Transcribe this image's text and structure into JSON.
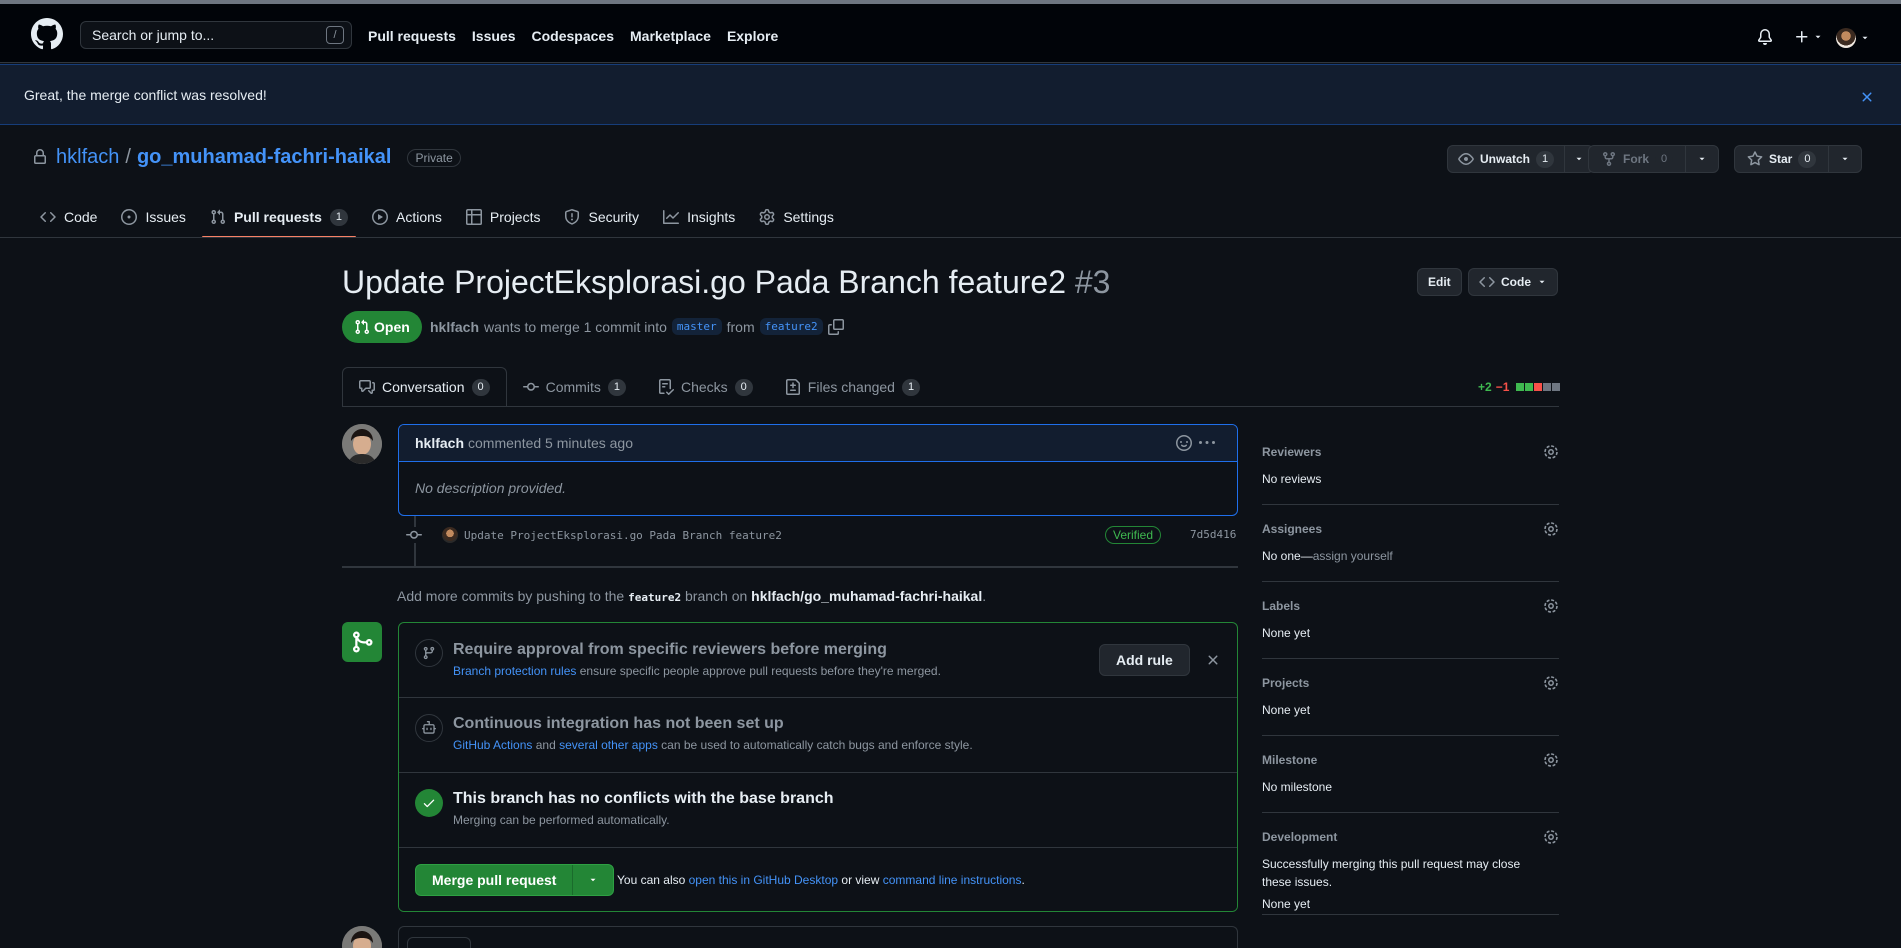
{
  "header": {
    "search_placeholder": "Search or jump to...",
    "search_key": "/",
    "nav": [
      "Pull requests",
      "Issues",
      "Codespaces",
      "Marketplace",
      "Explore"
    ]
  },
  "flash": {
    "message": "Great, the merge conflict was resolved!"
  },
  "repo": {
    "owner": "hklfach",
    "separator": "/",
    "name": "go_muhamad-fachri-haikal",
    "visibility": "Private",
    "unwatch_label": "Unwatch",
    "unwatch_count": "1",
    "fork_label": "Fork",
    "fork_count": "0",
    "star_label": "Star",
    "star_count": "0"
  },
  "repo_tabs": {
    "code": "Code",
    "issues": "Issues",
    "pull_requests": "Pull requests",
    "pull_requests_count": "1",
    "actions": "Actions",
    "projects": "Projects",
    "security": "Security",
    "insights": "Insights",
    "settings": "Settings"
  },
  "pr": {
    "title": "Update ProjectEksplorasi.go Pada Branch feature2",
    "number": "#3",
    "edit_label": "Edit",
    "code_label": "Code",
    "state": "Open",
    "author": "hklfach",
    "meta_text": "wants to merge 1 commit into",
    "base_branch": "master",
    "from_text": "from",
    "head_branch": "feature2"
  },
  "pr_tabs": {
    "conversation": "Conversation",
    "conversation_count": "0",
    "commits": "Commits",
    "commits_count": "1",
    "checks": "Checks",
    "checks_count": "0",
    "files": "Files changed",
    "files_count": "1",
    "additions": "+2",
    "deletions": "−1"
  },
  "comment": {
    "author": "hklfach",
    "action": "commented 5 minutes ago",
    "body": "No description provided."
  },
  "commit": {
    "message": "Update ProjectEksplorasi.go Pada Branch feature2",
    "verified": "Verified",
    "sha": "7d5d416"
  },
  "push_note": {
    "prefix": "Add more commits by pushing to the",
    "branch": "feature2",
    "middle": "branch on",
    "repo": "hklfach/go_muhamad-fachri-haikal",
    "suffix": "."
  },
  "mergebox": {
    "protection_title": "Require approval from specific reviewers before merging",
    "protection_link": "Branch protection rules",
    "protection_text": "ensure specific people approve pull requests before they're merged.",
    "add_rule": "Add rule",
    "ci_title": "Continuous integration has not been set up",
    "ci_link1": "GitHub Actions",
    "ci_and": "and",
    "ci_link2": "several other apps",
    "ci_text": "can be used to automatically catch bugs and enforce style.",
    "conflict_title": "This branch has no conflicts with the base branch",
    "conflict_sub": "Merging can be performed automatically.",
    "merge_button": "Merge pull request",
    "also_prefix": "You can also",
    "also_link1": "open this in GitHub Desktop",
    "also_mid": "or view",
    "also_link2": "command line instructions",
    "also_suffix": "."
  },
  "sidebar": {
    "reviewers_h": "Reviewers",
    "reviewers_v": "No reviews",
    "assignees_h": "Assignees",
    "assignees_v1": "No one—",
    "assignees_v2": "assign yourself",
    "labels_h": "Labels",
    "labels_v": "None yet",
    "projects_h": "Projects",
    "projects_v": "None yet",
    "milestone_h": "Milestone",
    "milestone_v": "No milestone",
    "development_h": "Development",
    "development_text": "Successfully merging this pull request may close these issues.",
    "development_v": "None yet"
  },
  "colors": {
    "accent": "#4493f8",
    "success": "#238636",
    "danger": "#f85149",
    "tab_underline": "#f78166"
  }
}
